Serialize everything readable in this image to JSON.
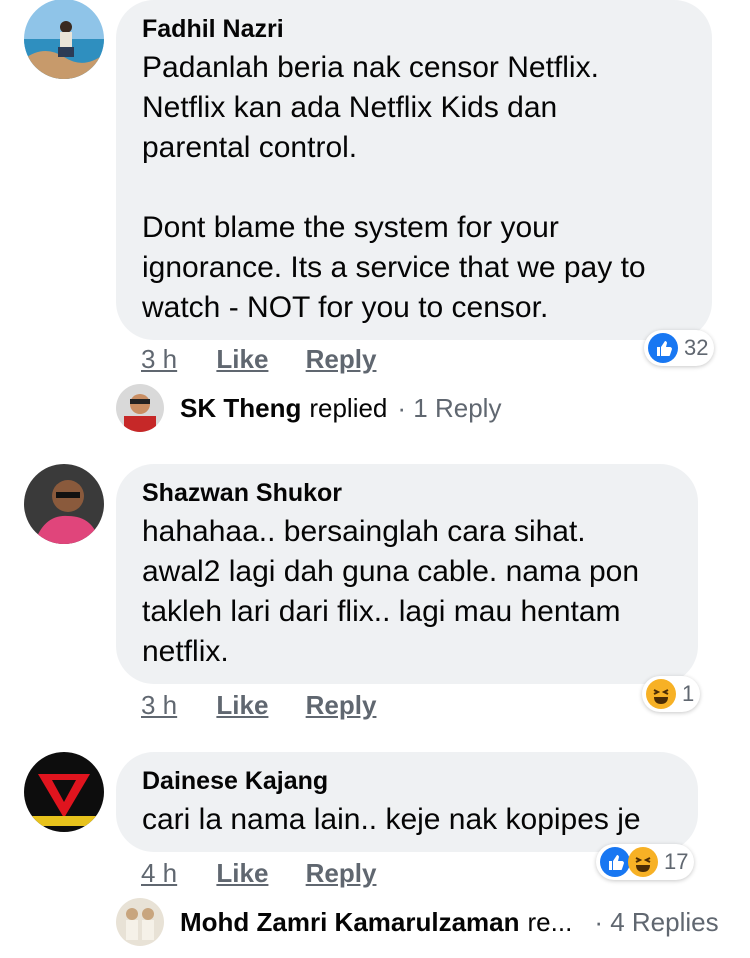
{
  "comments": [
    {
      "author": "Fadhil Nazri",
      "text": [
        "Padanlah beria nak censor Netflix.",
        "Netflix kan ada Netflix Kids dan",
        "parental control."
      ],
      "text2": [
        "Dont blame the system for your",
        "ignorance. Its a service that we pay to",
        "watch - NOT for you to censor."
      ],
      "time": "3 h",
      "like": "Like",
      "reply": "Reply",
      "reaction_count": "32",
      "reactions": [
        "like-icon"
      ],
      "reply_preview": {
        "name": "SK Theng",
        "verb": "replied",
        "count": "· 1 Reply"
      }
    },
    {
      "author": "Shazwan Shukor",
      "text": [
        "hahahaa.. bersainglah cara sihat.",
        "awal2 lagi dah guna cable. nama pon",
        "takleh lari dari flix.. lagi mau hentam",
        "netflix."
      ],
      "time": "3 h",
      "like": "Like",
      "reply": "Reply",
      "reaction_count": "1",
      "reactions": [
        "haha-icon"
      ]
    },
    {
      "author": "Dainese Kajang",
      "text": [
        "cari la nama lain.. keje nak kopipes je"
      ],
      "time": "4 h",
      "like": "Like",
      "reply": "Reply",
      "reaction_count": "17",
      "reactions": [
        "like-icon",
        "haha-icon"
      ],
      "reply_preview": {
        "name": "Mohd Zamri Kamarulzaman",
        "verb": "re...",
        "count": "· 4 Replies"
      }
    }
  ],
  "colors": {
    "bubble": "#eff1f3",
    "like_blue": "#1877f2",
    "haha_yellow": "#f7b125",
    "meta_gray": "#606770"
  }
}
